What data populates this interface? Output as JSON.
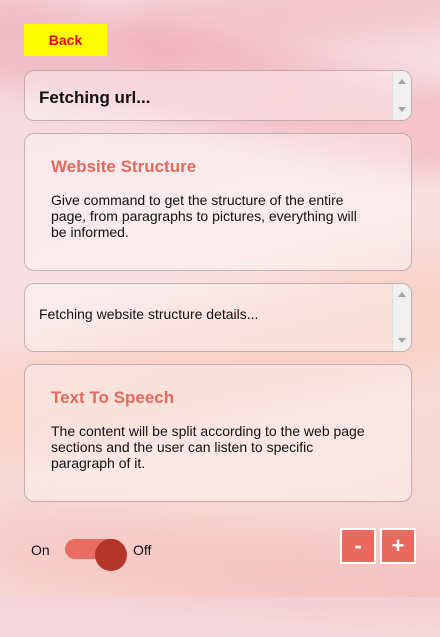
{
  "back_button": "Back",
  "url_status": "Fetching url...",
  "cards": [
    {
      "title": "Website Structure",
      "body": "Give command to get the structure of the entire page, from paragraphs to pictures, everything will be informed."
    },
    {
      "title": "Text To Speech",
      "body": "The content will be split according to the web page sections and the user can listen to specific paragraph of it."
    }
  ],
  "structure_status": "Fetching website structure details...",
  "toggle": {
    "on_label": "On",
    "off_label": "Off",
    "state": "on"
  },
  "size_controls": {
    "decrease": "-",
    "increase": "+"
  },
  "colors": {
    "accent": "#e8695d",
    "back_button_bg": "#ffff00",
    "back_button_text": "#e8001c",
    "card_title": "#e46a5c"
  }
}
